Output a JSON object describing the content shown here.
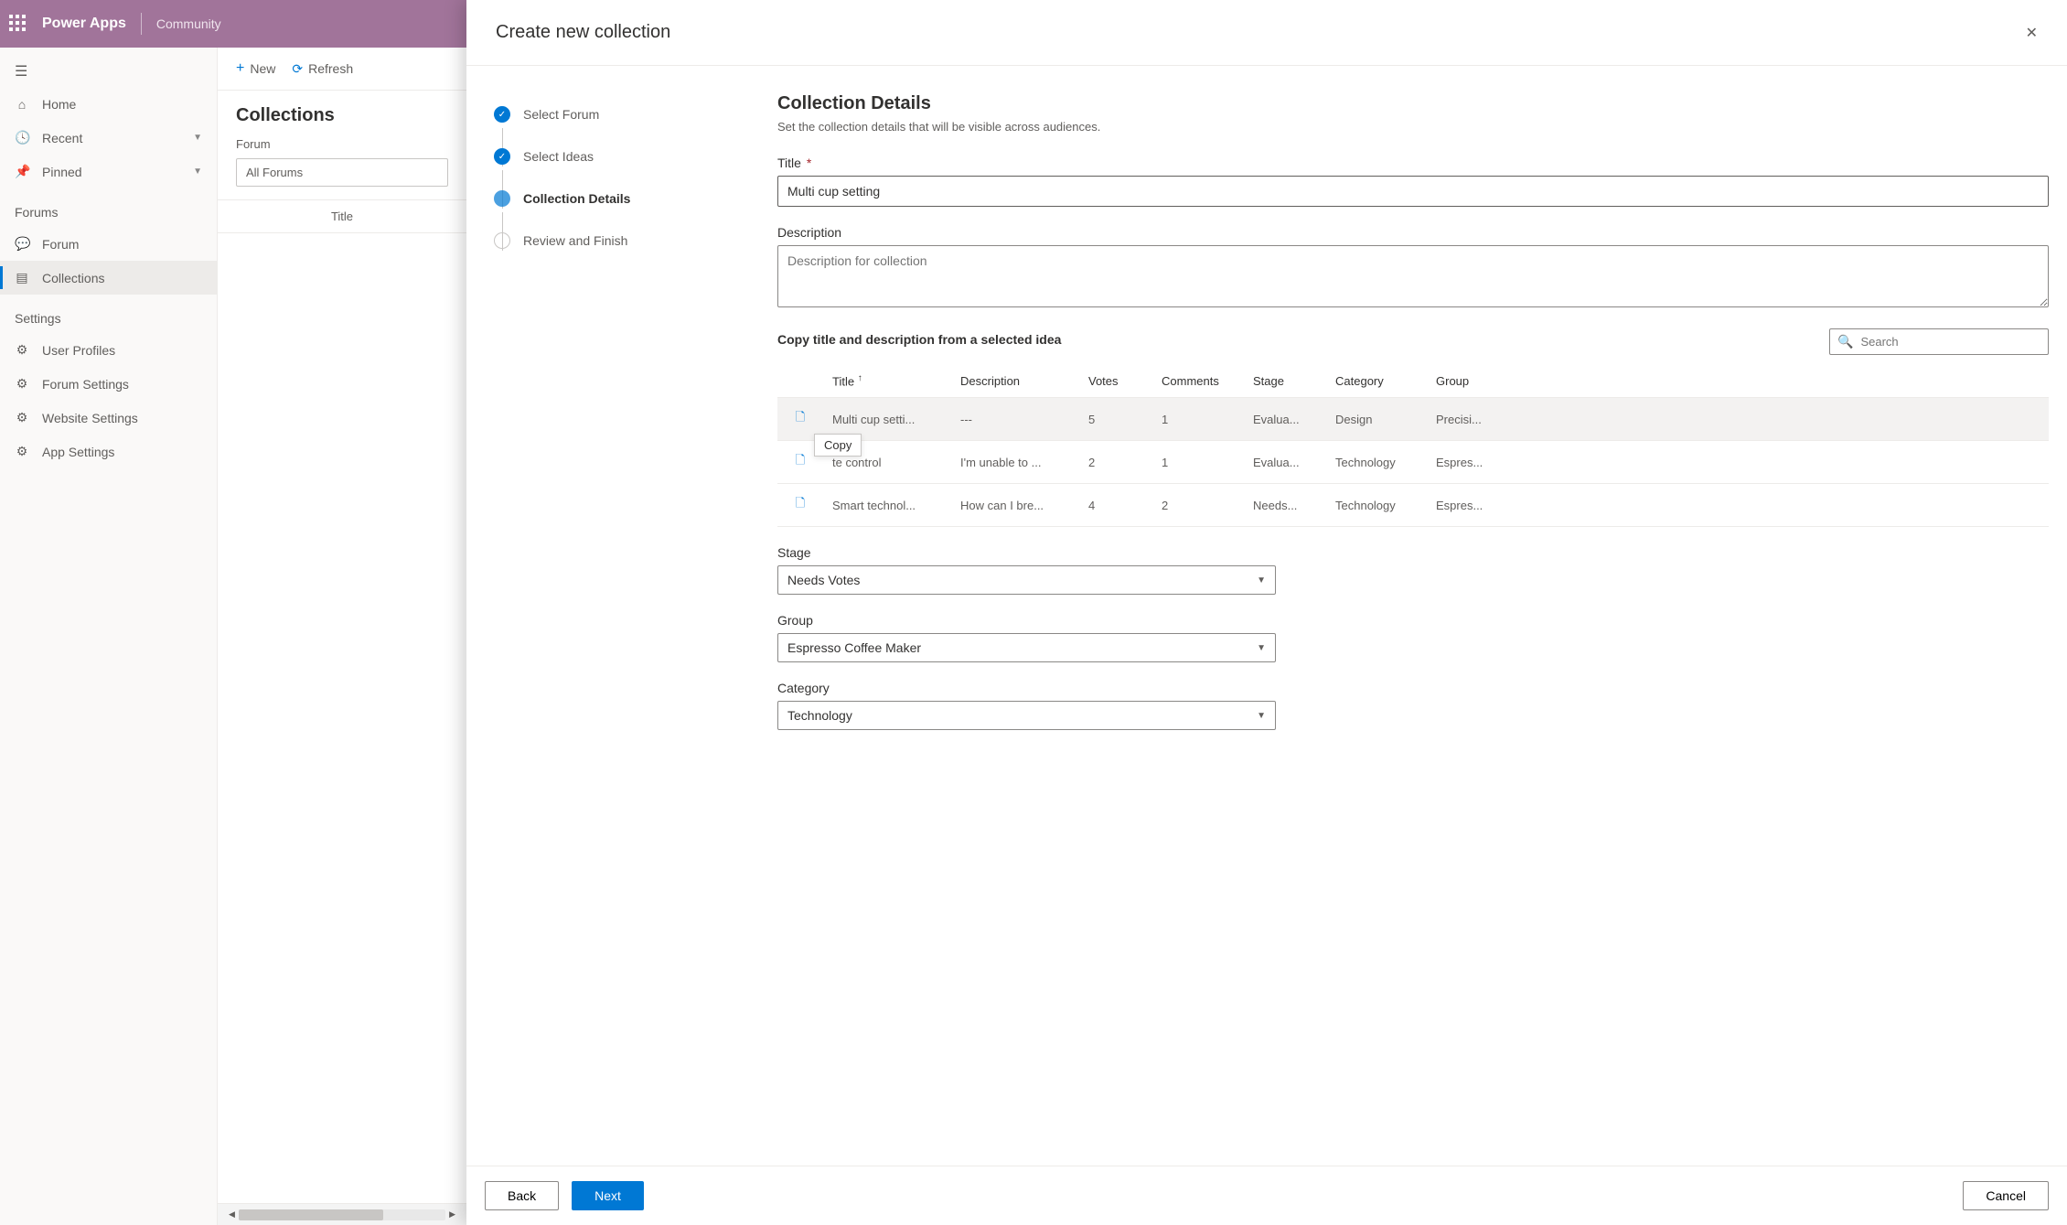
{
  "header": {
    "app_name": "Power Apps",
    "sub": "Community"
  },
  "nav": {
    "home": "Home",
    "recent": "Recent",
    "pinned": "Pinned",
    "section_forums": "Forums",
    "forum": "Forum",
    "collections": "Collections",
    "section_settings": "Settings",
    "user_profiles": "User Profiles",
    "forum_settings": "Forum Settings",
    "website_settings": "Website Settings",
    "app_settings": "App Settings"
  },
  "mid": {
    "new": "New",
    "refresh": "Refresh",
    "title": "Collections",
    "forum_label": "Forum",
    "forum_value": "All Forums",
    "col_title": "Title"
  },
  "panel": {
    "title": "Create new collection",
    "wizard": {
      "step1": "Select Forum",
      "step2": "Select Ideas",
      "step3": "Collection Details",
      "step4": "Review and Finish"
    },
    "content": {
      "heading": "Collection Details",
      "desc": "Set the collection details that will be visible across audiences.",
      "title_label": "Title",
      "title_value": "Multi cup setting",
      "desc_label": "Description",
      "desc_placeholder": "Description for collection",
      "copy_label": "Copy title and description from a selected idea",
      "search_placeholder": "Search",
      "tooltip": "Copy",
      "table": {
        "headers": {
          "title": "Title",
          "desc": "Description",
          "votes": "Votes",
          "comments": "Comments",
          "stage": "Stage",
          "category": "Category",
          "group": "Group"
        },
        "rows": [
          {
            "title": "Multi cup setti...",
            "desc": "---",
            "votes": "5",
            "comments": "1",
            "stage": "Evalua...",
            "category": "Design",
            "group": "Precisi..."
          },
          {
            "title": "te control",
            "desc": "I'm unable to ...",
            "votes": "2",
            "comments": "1",
            "stage": "Evalua...",
            "category": "Technology",
            "group": "Espres..."
          },
          {
            "title": "Smart technol...",
            "desc": "How can I bre...",
            "votes": "4",
            "comments": "2",
            "stage": "Needs...",
            "category": "Technology",
            "group": "Espres..."
          }
        ]
      },
      "stage_label": "Stage",
      "stage_value": "Needs Votes",
      "group_label": "Group",
      "group_value": "Espresso Coffee Maker",
      "category_label": "Category",
      "category_value": "Technology"
    },
    "footer": {
      "back": "Back",
      "next": "Next",
      "cancel": "Cancel"
    }
  }
}
